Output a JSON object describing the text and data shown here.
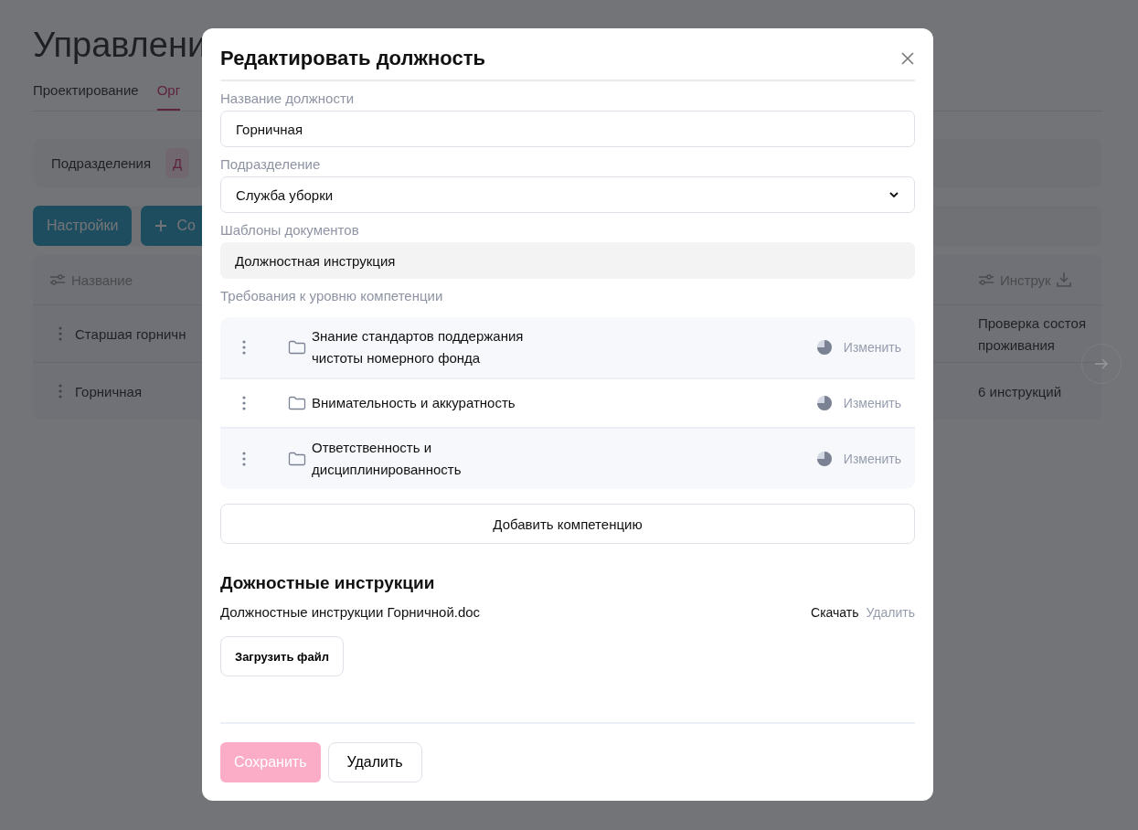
{
  "page": {
    "title": "Управлени",
    "tabs": [
      {
        "label": "Проектирование",
        "selected": false
      },
      {
        "label": "Орг",
        "selected": true
      }
    ],
    "subtabs": [
      {
        "label": "Подразделения",
        "selected": false
      },
      {
        "label": "Д",
        "selected": true
      }
    ],
    "buttons": [
      {
        "label": "Настройки",
        "kind": "plain"
      },
      {
        "label": "Со",
        "kind": "add"
      }
    ],
    "table": {
      "columns": [
        "Название",
        "Инструк"
      ],
      "rows": [
        {
          "name": "Старшая горничн",
          "instructions": [
            "Проверка состоя",
            "проживания"
          ]
        },
        {
          "name": "Горничная",
          "instructions": [
            "6 инструкций"
          ]
        }
      ]
    }
  },
  "dialog": {
    "title": "Редактировать должность",
    "fields": [
      {
        "label": "Название должности",
        "kind": "input",
        "value": "Горничная"
      },
      {
        "label": "Подразделение",
        "kind": "select",
        "value": "Служба уборки"
      },
      {
        "label": "Шаблоны документов",
        "kind": "static",
        "value": "Должностная инструкция"
      }
    ],
    "competence_label": "Требования к уровню компетенции",
    "competences": [
      {
        "lines": [
          "Знание стандартов поддержания",
          "чистоты номерного фонда"
        ],
        "action": "Изменить"
      },
      {
        "lines": [
          "Внимательность и аккуратность"
        ],
        "action": "Изменить"
      },
      {
        "lines": [
          "Ответственность и",
          "дисциплинированность"
        ],
        "action": "Изменить"
      }
    ],
    "add_competence": "Добавить компетенцию",
    "instructions_title": "Дожностные инструкции",
    "files": [
      {
        "name": "Должностные инструкции Горничной.doc",
        "download": "Скачать",
        "delete": "Удалить"
      }
    ],
    "upload": "Загрузить файл",
    "save": {
      "label": "Сохранить",
      "disabled": true
    },
    "delete": "Удалить"
  }
}
